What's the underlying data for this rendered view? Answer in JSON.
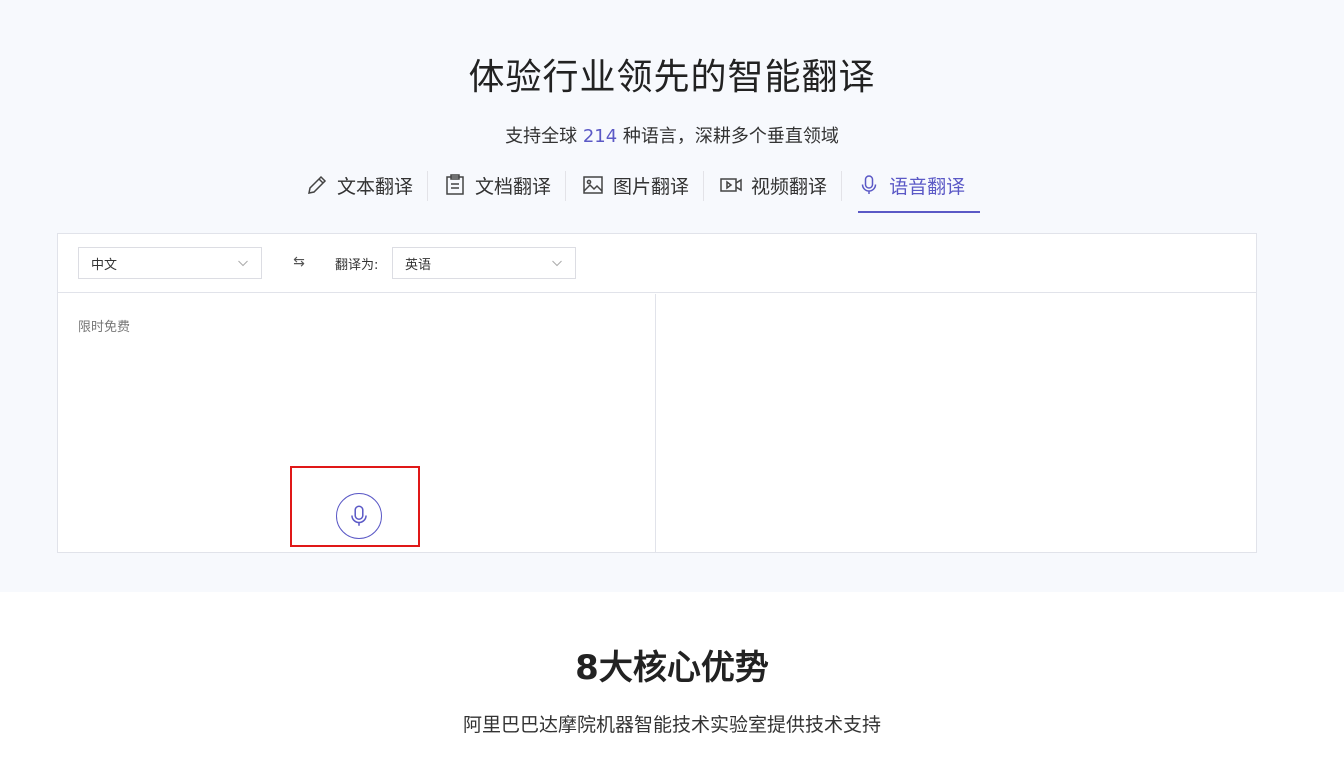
{
  "hero": {
    "title": "体验行业领先的智能翻译",
    "subtitle_prefix": "支持全球 ",
    "subtitle_count": "214",
    "subtitle_suffix": " 种语言，深耕多个垂直领域"
  },
  "tabs": [
    {
      "label": "文本翻译",
      "icon": "pencil-icon"
    },
    {
      "label": "文档翻译",
      "icon": "document-icon"
    },
    {
      "label": "图片翻译",
      "icon": "image-icon"
    },
    {
      "label": "视频翻译",
      "icon": "video-icon"
    },
    {
      "label": "语音翻译",
      "icon": "microphone-icon",
      "active": true
    }
  ],
  "translator": {
    "source_language": "中文",
    "target_label": "翻译为:",
    "target_language": "英语",
    "swap_icon": "swap-icon",
    "input_placeholder": "限时免费",
    "record_icon": "microphone-icon"
  },
  "advantages": {
    "title": "8大核心优势",
    "subtitle": "阿里巴巴达摩院机器智能技术实验室提供技术支持"
  },
  "colors": {
    "accent": "#5b59c6",
    "hero_bg": "#f7f9fd",
    "highlight": "#e01818"
  }
}
